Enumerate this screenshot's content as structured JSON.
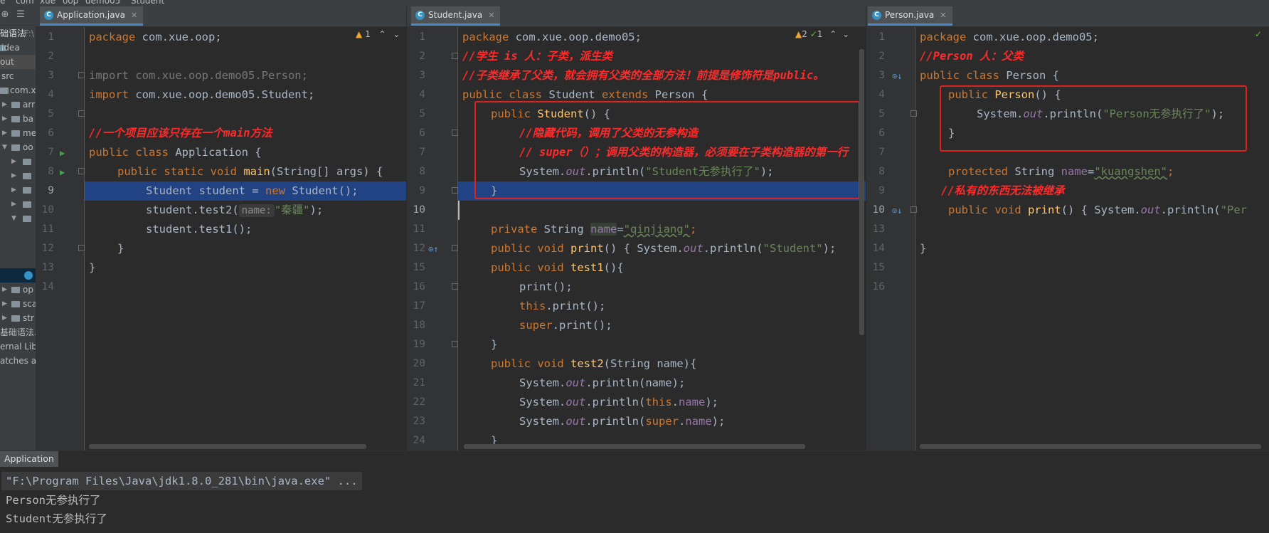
{
  "breadcrumb": [
    "e",
    "com",
    "xue",
    "oop",
    "demo05",
    "Student"
  ],
  "sidebar": {
    "project_name": "础语法",
    "project_path": "F:\\",
    "rows": [
      {
        "label": "idea",
        "kind": "folder"
      },
      {
        "label": "out",
        "kind": "folder",
        "selected": true
      },
      {
        "label": "src",
        "kind": "folder"
      },
      {
        "label": "com.x",
        "kind": "package"
      },
      {
        "label": "arr",
        "kind": "package"
      },
      {
        "label": "ba",
        "kind": "package"
      },
      {
        "label": "me",
        "kind": "package"
      },
      {
        "label": "oo",
        "kind": "package"
      },
      {
        "label": "",
        "kind": "package"
      },
      {
        "label": "",
        "kind": "package"
      },
      {
        "label": "",
        "kind": "package"
      },
      {
        "label": "",
        "kind": "package"
      },
      {
        "label": "",
        "kind": "package"
      },
      {
        "label": "op",
        "kind": "package"
      },
      {
        "label": "sca",
        "kind": "package"
      },
      {
        "label": "str",
        "kind": "package"
      },
      {
        "label": "基础语法.",
        "kind": "file"
      },
      {
        "label": "ernal Libr",
        "kind": "lib"
      },
      {
        "label": "atches ar",
        "kind": "lib"
      }
    ]
  },
  "panes": [
    {
      "tab": "Application.java",
      "inspection": {
        "warnings": "1"
      },
      "lines": [
        "1",
        "2",
        "3",
        "4",
        "5",
        "6",
        "7",
        "8",
        "9",
        "10",
        "11",
        "12",
        "13",
        "14"
      ],
      "code": {
        "l1_kw": "package",
        "l1_rest": " com.xue.oop;",
        "l3": "import com.xue.oop.demo05.Person;",
        "l4_kw": "import",
        "l4_rest": " com.xue.oop.demo05.Student;",
        "l6": "//一个项目应该只存在一个main方法",
        "l7_kw": "public class",
        "l7_rest": " Application {",
        "l8_kw": "public static void",
        "l8_fn": "main",
        "l8_rest": "(String[] args) {",
        "l9_a": "Student student = ",
        "l9_kw": "new",
        "l9_b": " Student();",
        "l10_a": "student.test2(",
        "l10_hint": "name:",
        "l10_str": "\"秦疆\"",
        "l10_b": ");",
        "l11": "student.test1();",
        "l12": "}",
        "l13": "}"
      }
    },
    {
      "tab": "Student.java",
      "inspection": {
        "warnings": "2",
        "ok": "1"
      },
      "lines": [
        "1",
        "2",
        "3",
        "4",
        "5",
        "6",
        "7",
        "8",
        "9",
        "10",
        "11",
        "12",
        "15",
        "16",
        "17",
        "18",
        "19",
        "20",
        "21",
        "22",
        "23",
        "24"
      ],
      "code": {
        "l1_kw": "package",
        "l1_rest": " com.xue.oop.demo05;",
        "l2": "//学生 is 人：子类，派生类",
        "l3": "//子类继承了父类，就会拥有父类的全部方法！前提是修饰符是public。",
        "l4_kw": "public class",
        "l4_a": " Student ",
        "l4_kw2": "extends",
        "l4_b": " Person {",
        "l5_kw": "public",
        "l5_fn": "Student",
        "l5_rest": "() {",
        "l6": "//隐藏代码，调用了父类的无参构造",
        "l7": "// super（）；调用父类的构造器，必须要在子类构造器的第一行",
        "l8_a": "System.",
        "l8_st": "out",
        "l8_b": ".println(",
        "l8_str": "\"Student无参执行了\"",
        "l8_c": ");",
        "l9": "}",
        "l11_kw": "private",
        "l11_a": " String ",
        "l11_fld": "name",
        "l11_b": "=",
        "l11_str": "\"qinjiang\"",
        "l11_c": ";",
        "l12_kw": "public void",
        "l12_fn": "print",
        "l12_a": "() { System.",
        "l12_st": "out",
        "l12_b": ".println(",
        "l12_str": "\"Student\"",
        "l12_c": ");",
        "l15_kw": "public void",
        "l15_fn": "test1",
        "l15_rest": "(){",
        "l16": "print();",
        "l17_kw": "this",
        "l17_rest": ".print();",
        "l18_kw": "super",
        "l18_rest": ".print();",
        "l19": "}",
        "l20_kw": "public void",
        "l20_fn": "test2",
        "l20_rest": "(String name){",
        "l21_a": "System.",
        "l21_st": "out",
        "l21_b": ".println(name);",
        "l22_a": "System.",
        "l22_st": "out",
        "l22_b": ".println(",
        "l22_kw": "this",
        "l22_c": ".",
        "l22_fld": "name",
        "l22_d": ");",
        "l23_a": "System.",
        "l23_st": "out",
        "l23_b": ".println(",
        "l23_kw": "super",
        "l23_c": ".",
        "l23_fld": "name",
        "l23_d": ");",
        "l24": "}"
      }
    },
    {
      "tab": "Person.java",
      "inspection": {
        "ok": ""
      },
      "lines": [
        "1",
        "2",
        "3",
        "4",
        "5",
        "6",
        "7",
        "8",
        "9",
        "10",
        "13",
        "14",
        "15",
        "16"
      ],
      "code": {
        "l1_kw": "package",
        "l1_rest": " com.xue.oop.demo05;",
        "l2": "//Person 人：父类",
        "l3_kw": "public class",
        "l3_rest": " Person {",
        "l4_kw": "public",
        "l4_fn": "Person",
        "l4_rest": "() {",
        "l5_a": "System.",
        "l5_st": "out",
        "l5_b": ".println(",
        "l5_str": "\"Person无参执行了\"",
        "l5_c": ");",
        "l6": "}",
        "l8_kw": "protected",
        "l8_a": " String ",
        "l8_fld": "name",
        "l8_b": "=",
        "l8_str": "\"kuangshen\"",
        "l8_c": ";",
        "l9": "//私有的东西无法被继承",
        "l10_kw": "public void",
        "l10_fn": "print",
        "l10_a": "() { System.",
        "l10_st": "out",
        "l10_b": ".println(",
        "l10_str": "\"Per",
        "l14": "}"
      }
    }
  ],
  "run": {
    "tab": "Application",
    "command": "\"F:\\Program Files\\Java\\jdk1.8.0_281\\bin\\java.exe\" ...",
    "output": [
      "Person无参执行了",
      "Student无参执行了"
    ]
  },
  "colors": {
    "keyword": "#cc7832",
    "string": "#6a8759",
    "comment": "#ff2b2b",
    "function": "#ffc66d",
    "static": "#9876aa",
    "selection": "#214283",
    "annotation_box": "#e0211c"
  }
}
